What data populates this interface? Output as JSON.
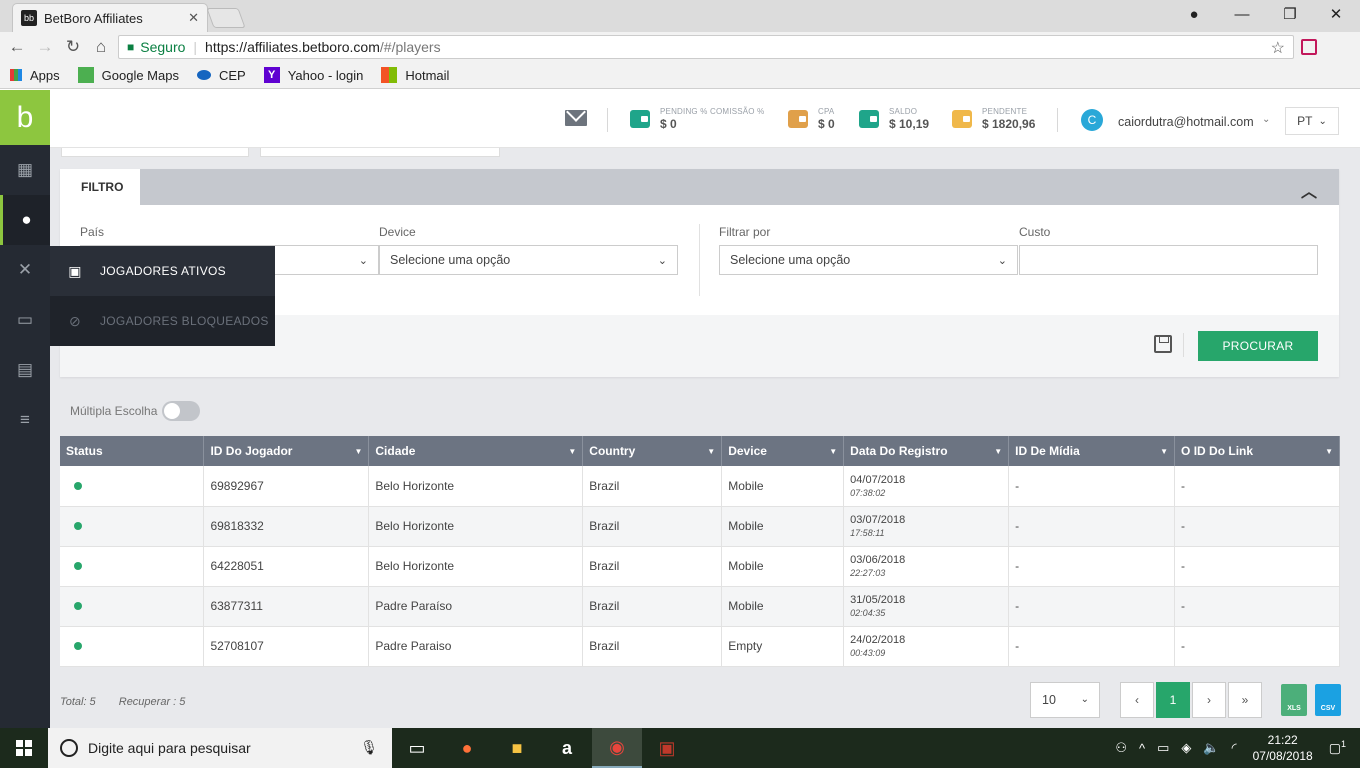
{
  "browser": {
    "tab_title": "BetBoro Affiliates",
    "tab_favicon": "bb",
    "close_glyph": "✕",
    "secure_label": "Seguro",
    "url_host": "https://affiliates.betboro.com",
    "url_path": "/#/players",
    "bookmarks": [
      {
        "label": "Apps",
        "icon": "apps-grid-icon"
      },
      {
        "label": "Google Maps",
        "icon": "google-maps-icon"
      },
      {
        "label": "CEP",
        "icon": "cep-icon"
      },
      {
        "label": "Yahoo - login",
        "icon": "yahoo-icon",
        "glyph": "Y"
      },
      {
        "label": "Hotmail",
        "icon": "windows-icon"
      }
    ]
  },
  "header": {
    "stats": [
      {
        "label": "PENDING % COMISSÃO %",
        "value": "$ 0",
        "color": "#1fa58a"
      },
      {
        "label": "CPA",
        "value": "$ 0",
        "color": "#e0a04a"
      },
      {
        "label": "SALDO",
        "value": "$ 10,19",
        "color": "#1fa58a"
      },
      {
        "label": "PENDENTE",
        "value": "$ 1820,96",
        "color": "#f0b84a"
      }
    ],
    "avatar_letter": "C",
    "user_email": "caiordutra@hotmail.com",
    "language": "PT"
  },
  "submenu": {
    "items": [
      {
        "label": "JOGADORES ATIVOS",
        "icon": "id-card-icon",
        "glyph": "▣"
      },
      {
        "label": "JOGADORES BLOQUEADOS",
        "icon": "blocked-icon",
        "glyph": "⊘"
      }
    ]
  },
  "filter": {
    "tab_label": "FILTRO",
    "fields": {
      "pais_label": "País",
      "device_label": "Device",
      "device_value": "Selecione uma opção",
      "filtrar_label": "Filtrar por",
      "filtrar_value": "Selecione uma opção",
      "custo_label": "Custo"
    },
    "search_button": "PROCURAR"
  },
  "multi_label": "Múltipla Escolha",
  "table": {
    "columns": [
      "Status",
      "ID Do Jogador",
      "Cidade",
      "Country",
      "Device",
      "Data Do Registro",
      "ID De Mídia",
      "O ID Do Link"
    ],
    "rows": [
      {
        "id": "69892967",
        "city": "Belo Horizonte",
        "country": "Brazil",
        "device": "Mobile",
        "date": "04/07/2018",
        "time": "07:38:02",
        "media": "-",
        "link": "-"
      },
      {
        "id": "69818332",
        "city": "Belo Horizonte",
        "country": "Brazil",
        "device": "Mobile",
        "date": "03/07/2018",
        "time": "17:58:11",
        "media": "-",
        "link": "-"
      },
      {
        "id": "64228051",
        "city": "Belo Horizonte",
        "country": "Brazil",
        "device": "Mobile",
        "date": "03/06/2018",
        "time": "22:27:03",
        "media": "-",
        "link": "-"
      },
      {
        "id": "63877311",
        "city": "Padre Paraíso",
        "country": "Brazil",
        "device": "Mobile",
        "date": "31/05/2018",
        "time": "02:04:35",
        "media": "-",
        "link": "-"
      },
      {
        "id": "52708107",
        "city": "Padre Paraiso",
        "country": "Brazil",
        "device": "Empty",
        "date": "24/02/2018",
        "time": "00:43:09",
        "media": "-",
        "link": "-"
      }
    ]
  },
  "footer": {
    "total": "Total: 5",
    "recuperar": "Recuperar : 5",
    "per_page": "10",
    "pages": [
      "‹",
      "1",
      "›",
      "»"
    ],
    "xls": "XLS",
    "csv": "CSV"
  },
  "taskbar": {
    "search_placeholder": "Digite aqui para pesquisar",
    "time": "21:22",
    "date": "07/08/2018",
    "notifications": "1"
  },
  "colors": {
    "accent_green": "#27a66b",
    "logo_green": "#8dc63f",
    "sidebar": "#252a33"
  }
}
